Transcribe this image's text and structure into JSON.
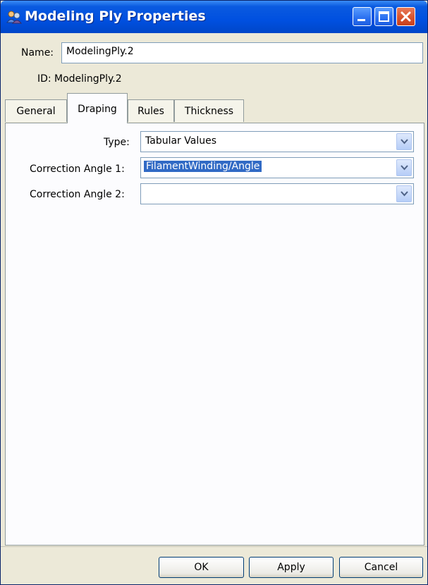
{
  "window": {
    "title": "Modeling Ply Properties",
    "title_icon": "plies-icon",
    "controls": [
      "minimize-icon",
      "maximize-icon",
      "close-icon"
    ]
  },
  "header": {
    "name_label": "Name:",
    "name_value": "ModelingPly.2",
    "id_label": "ID:",
    "id_value": "ModelingPly.2"
  },
  "tabs": [
    {
      "label": "General",
      "active": false
    },
    {
      "label": "Draping",
      "active": true
    },
    {
      "label": "Rules",
      "active": false
    },
    {
      "label": "Thickness",
      "active": false
    }
  ],
  "draping": {
    "type_label": "Type:",
    "type_value": "Tabular Values",
    "angle1_label": "Correction Angle 1:",
    "angle1_value": "FilamentWinding/Angle",
    "angle2_label": "Correction Angle 2:",
    "angle2_value": ""
  },
  "buttons": {
    "ok": "OK",
    "apply": "Apply",
    "cancel": "Cancel"
  },
  "colors": {
    "titlebar": "#0054e3",
    "selection": "#316ac5",
    "close_button": "#d9542e"
  }
}
